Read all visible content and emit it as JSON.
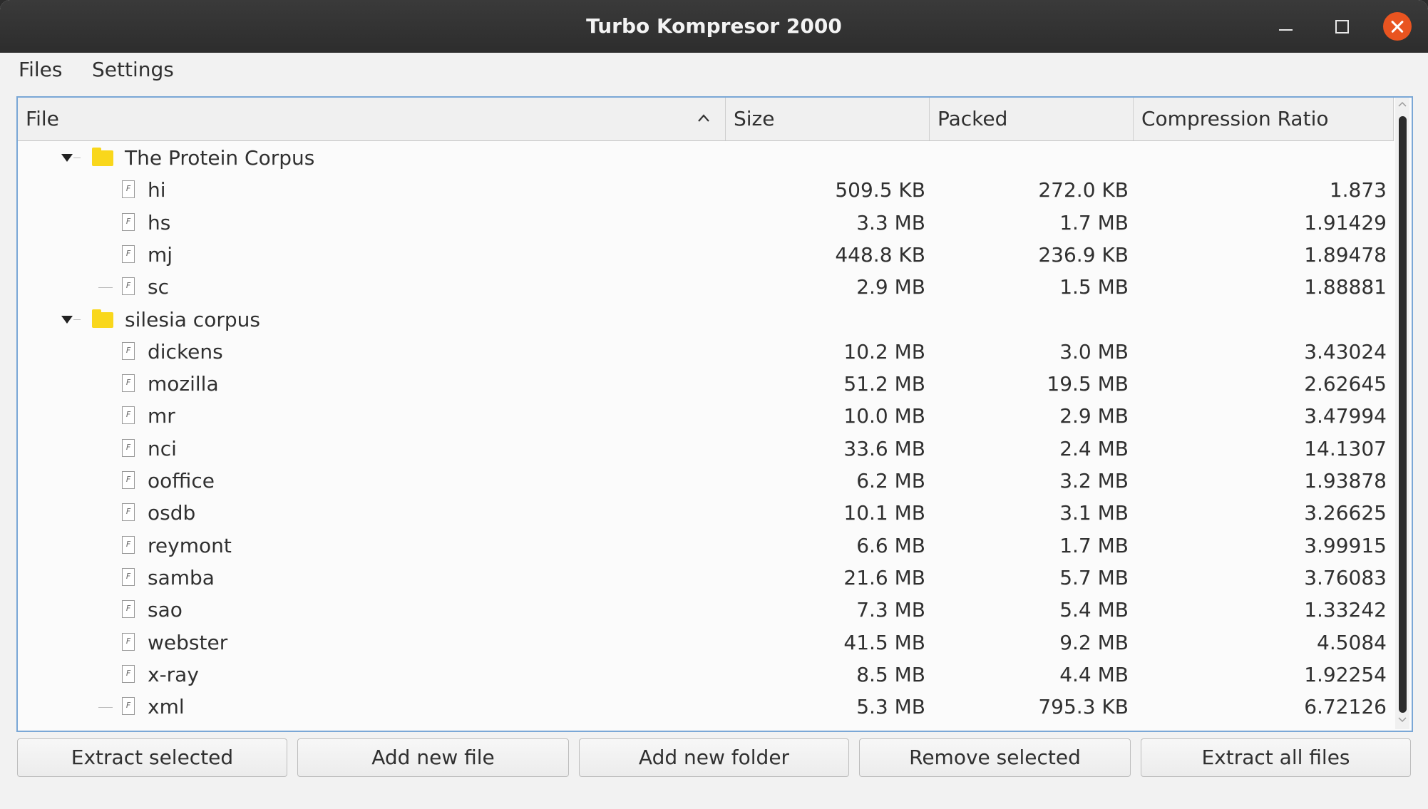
{
  "window": {
    "title": "Turbo Kompresor 2000"
  },
  "menu": {
    "files": "Files",
    "settings": "Settings"
  },
  "table": {
    "columns": [
      "File",
      "Size",
      "Packed",
      "Compression Ratio"
    ],
    "sort": "ascending by File",
    "folders": [
      {
        "name": "The Protein Corpus",
        "expanded": true,
        "files": [
          {
            "name": "hi",
            "size": "509.5 KB",
            "packed": "272.0 KB",
            "ratio": "1.873"
          },
          {
            "name": "hs",
            "size": "3.3 MB",
            "packed": "1.7 MB",
            "ratio": "1.91429"
          },
          {
            "name": "mj",
            "size": "448.8 KB",
            "packed": "236.9 KB",
            "ratio": "1.89478"
          },
          {
            "name": "sc",
            "size": "2.9 MB",
            "packed": "1.5 MB",
            "ratio": "1.88881"
          }
        ]
      },
      {
        "name": "silesia corpus",
        "expanded": true,
        "files": [
          {
            "name": "dickens",
            "size": "10.2 MB",
            "packed": "3.0 MB",
            "ratio": "3.43024"
          },
          {
            "name": "mozilla",
            "size": "51.2 MB",
            "packed": "19.5 MB",
            "ratio": "2.62645"
          },
          {
            "name": "mr",
            "size": "10.0 MB",
            "packed": "2.9 MB",
            "ratio": "3.47994"
          },
          {
            "name": "nci",
            "size": "33.6 MB",
            "packed": "2.4 MB",
            "ratio": "14.1307"
          },
          {
            "name": "ooffice",
            "size": "6.2 MB",
            "packed": "3.2 MB",
            "ratio": "1.93878"
          },
          {
            "name": "osdb",
            "size": "10.1 MB",
            "packed": "3.1 MB",
            "ratio": "3.26625"
          },
          {
            "name": "reymont",
            "size": "6.6 MB",
            "packed": "1.7 MB",
            "ratio": "3.99915"
          },
          {
            "name": "samba",
            "size": "21.6 MB",
            "packed": "5.7 MB",
            "ratio": "3.76083"
          },
          {
            "name": "sao",
            "size": "7.3 MB",
            "packed": "5.4 MB",
            "ratio": "1.33242"
          },
          {
            "name": "webster",
            "size": "41.5 MB",
            "packed": "9.2 MB",
            "ratio": "4.5084"
          },
          {
            "name": "x-ray",
            "size": "8.5 MB",
            "packed": "4.4 MB",
            "ratio": "1.92254"
          },
          {
            "name": "xml",
            "size": "5.3 MB",
            "packed": "795.3 KB",
            "ratio": "6.72126"
          }
        ]
      }
    ]
  },
  "file_icon_glyph": "F",
  "buttons": {
    "extract_selected": "Extract selected",
    "add_new_file": "Add new file",
    "add_new_folder": "Add new folder",
    "remove_selected": "Remove selected",
    "extract_all_files": "Extract all files"
  },
  "colors": {
    "close_button": "#e95420",
    "folder_icon": "#f9d71c",
    "focus_border": "#7aa7d6",
    "titlebar": "#2d2d2d"
  }
}
